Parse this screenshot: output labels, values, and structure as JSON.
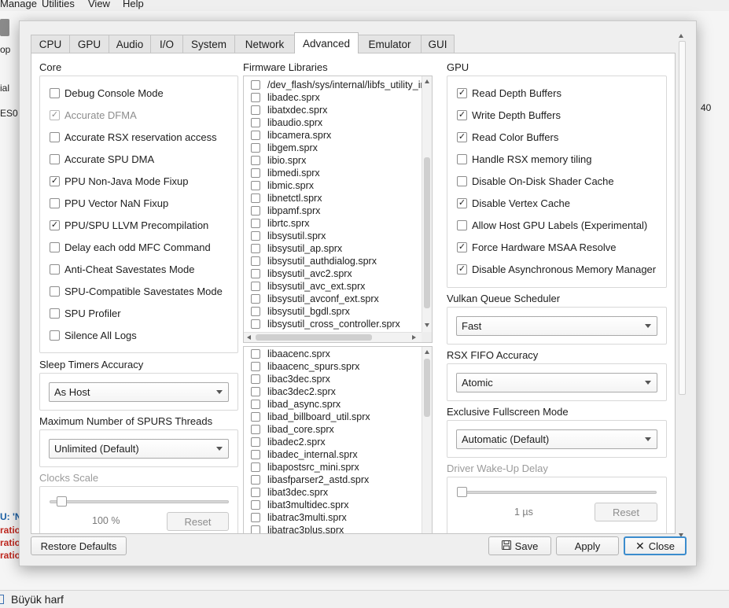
{
  "background": {
    "menu": [
      "Manage",
      "Utilities",
      "View",
      "Help"
    ],
    "fragments": {
      "op": "op",
      "ial": "ial",
      "es0": "ES0",
      "num40": "40",
      "log_u": "U: 'N",
      "log1": "ratio",
      "log2": "ratio",
      "log3": "ratio"
    },
    "bottom_label": "Büyük harf"
  },
  "dialog": {
    "tabs": [
      "CPU",
      "GPU",
      "Audio",
      "I/O",
      "System",
      "Network",
      "Advanced",
      "Emulator",
      "GUI"
    ],
    "active_tab": "Advanced",
    "core": {
      "title": "Core",
      "options": [
        {
          "label": "Debug Console Mode",
          "checked": false,
          "disabled": false
        },
        {
          "label": "Accurate DFMA",
          "checked": true,
          "disabled": true
        },
        {
          "label": "Accurate RSX reservation access",
          "checked": false,
          "disabled": false
        },
        {
          "label": "Accurate SPU DMA",
          "checked": false,
          "disabled": false
        },
        {
          "label": "PPU Non-Java Mode Fixup",
          "checked": true,
          "disabled": false
        },
        {
          "label": "PPU Vector NaN Fixup",
          "checked": false,
          "disabled": false
        },
        {
          "label": "PPU/SPU LLVM Precompilation",
          "checked": true,
          "disabled": false
        },
        {
          "label": "Delay each odd MFC Command",
          "checked": false,
          "disabled": false
        },
        {
          "label": "Anti-Cheat Savestates Mode",
          "checked": false,
          "disabled": false
        },
        {
          "label": "SPU-Compatible Savestates Mode",
          "checked": false,
          "disabled": false
        },
        {
          "label": "SPU Profiler",
          "checked": false,
          "disabled": false
        },
        {
          "label": "Silence All Logs",
          "checked": false,
          "disabled": false
        }
      ]
    },
    "sleep_timers": {
      "title": "Sleep Timers Accuracy",
      "value": "As Host"
    },
    "spurs_threads": {
      "title": "Maximum Number of SPURS Threads",
      "value": "Unlimited (Default)"
    },
    "clocks_scale": {
      "title": "Clocks Scale",
      "value_text": "100 %",
      "reset_label": "Reset",
      "level": 0.04
    },
    "firmware": {
      "title": "Firmware Libraries",
      "list1": [
        "/dev_flash/sys/internal/libfs_utility_init.sprx",
        "libadec.sprx",
        "libatxdec.sprx",
        "libaudio.sprx",
        "libcamera.sprx",
        "libgem.sprx",
        "libio.sprx",
        "libmedi.sprx",
        "libmic.sprx",
        "libnetctl.sprx",
        "libpamf.sprx",
        "librtc.sprx",
        "libsysutil.sprx",
        "libsysutil_ap.sprx",
        "libsysutil_authdialog.sprx",
        "libsysutil_avc2.sprx",
        "libsysutil_avc_ext.sprx",
        "libsysutil_avconf_ext.sprx",
        "libsysutil_bgdl.sprx",
        "libsysutil_cross_controller.sprx"
      ],
      "list2": [
        "libaacenc.sprx",
        "libaacenc_spurs.sprx",
        "libac3dec.sprx",
        "libac3dec2.sprx",
        "libad_async.sprx",
        "libad_billboard_util.sprx",
        "libad_core.sprx",
        "libadec2.sprx",
        "libadec_internal.sprx",
        "libapostsrc_mini.sprx",
        "libasfparser2_astd.sprx",
        "libat3dec.sprx",
        "libat3multidec.sprx",
        "libatrac3multi.sprx",
        "libatrac3plus.sprx"
      ]
    },
    "gpu": {
      "title": "GPU",
      "options": [
        {
          "label": "Read Depth Buffers",
          "checked": true
        },
        {
          "label": "Write Depth Buffers",
          "checked": true
        },
        {
          "label": "Read Color Buffers",
          "checked": true
        },
        {
          "label": "Handle RSX memory tiling",
          "checked": false
        },
        {
          "label": "Disable On-Disk Shader Cache",
          "checked": false
        },
        {
          "label": "Disable Vertex Cache",
          "checked": true
        },
        {
          "label": "Allow Host GPU Labels (Experimental)",
          "checked": false
        },
        {
          "label": "Force Hardware MSAA Resolve",
          "checked": true
        },
        {
          "label": "Disable Asynchronous Memory Manager",
          "checked": true
        }
      ]
    },
    "vulkan_queue": {
      "title": "Vulkan Queue Scheduler",
      "value": "Fast"
    },
    "rsx_fifo": {
      "title": "RSX FIFO Accuracy",
      "value": "Atomic"
    },
    "fullscreen": {
      "title": "Exclusive Fullscreen Mode",
      "value": "Automatic (Default)"
    },
    "wakeup": {
      "title": "Driver Wake-Up Delay",
      "value_text": "1 µs",
      "reset_label": "Reset",
      "level": 0.0
    },
    "buttons": {
      "restore": "Restore Defaults",
      "save": "Save",
      "apply": "Apply",
      "close": "Close"
    },
    "icons": {
      "save": "floppy-icon",
      "close": "close-icon"
    }
  }
}
